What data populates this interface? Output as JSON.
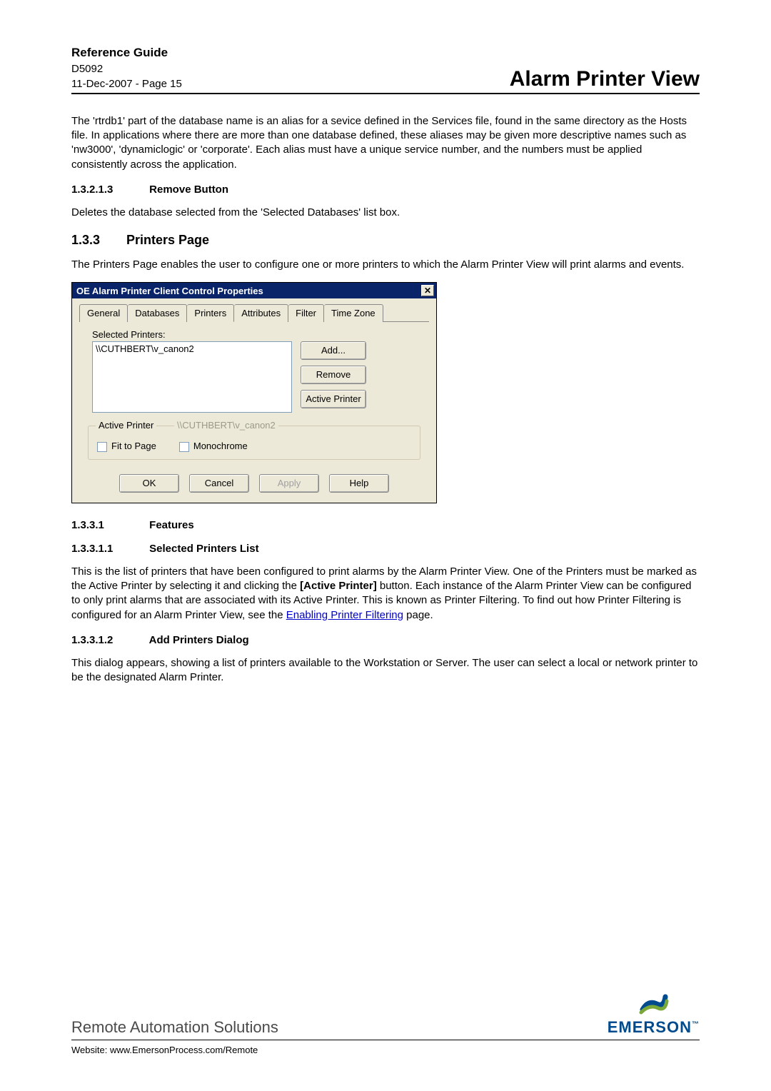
{
  "header": {
    "title": "Reference Guide",
    "doc_id": "D5092",
    "date_page": "11-Dec-2007 - Page 15",
    "section_title": "Alarm Printer View"
  },
  "para1": "The 'rtrdb1' part of the database name is an alias for a sevice defined in the Services file, found in the same directory as the Hosts file. In applications where there are more than one database defined, these aliases may be given more descriptive names such as 'nw3000', 'dynamiclogic' or 'corporate'. Each alias must have a unique service number, and the numbers must be applied consistently across the application.",
  "sec_13213": {
    "num": "1.3.2.1.3",
    "title": "Remove Button"
  },
  "para2": "Deletes the database selected from the 'Selected Databases' list box.",
  "sec_133": {
    "num": "1.3.3",
    "title": "Printers Page"
  },
  "para3": "The Printers Page enables the user to configure one or more printers to which the Alarm Printer View will print alarms and events.",
  "dialog": {
    "title": "OE Alarm Printer Client Control Properties",
    "tabs": [
      "General",
      "Databases",
      "Printers",
      "Attributes",
      "Filter",
      "Time Zone"
    ],
    "active_tab": "Printers",
    "selected_label": "Selected Printers:",
    "selected_items": [
      "\\\\CUTHBERT\\v_canon2"
    ],
    "btn_add": "Add...",
    "btn_remove": "Remove",
    "btn_active": "Active Printer",
    "group_legend": "Active Printer",
    "active_printer_name": "\\\\CUTHBERT\\v_canon2",
    "chk_fit": "Fit to Page",
    "chk_mono": "Monochrome",
    "btn_ok": "OK",
    "btn_cancel": "Cancel",
    "btn_apply": "Apply",
    "btn_help": "Help"
  },
  "sec_1331": {
    "num": "1.3.3.1",
    "title": "Features"
  },
  "sec_13311": {
    "num": "1.3.3.1.1",
    "title": "Selected Printers List"
  },
  "para4a": "This is the list of printers that have been configured to print alarms by the Alarm Printer View.  One of the Printers must be  marked as the Active Printer by selecting it and clicking the ",
  "para4b": "[Active Printer]",
  "para4c": " button. Each instance of the Alarm Printer View can be configured to only print alarms that are associated with its Active Printer. This is known as Printer Filtering. To find out how Printer Filtering is configured for an Alarm Printer View, see the ",
  "para4link": "Enabling Printer Filtering",
  "para4d": " page.",
  "sec_13312": {
    "num": "1.3.3.1.2",
    "title": "Add Printers Dialog"
  },
  "para5": "This dialog appears, showing a list of printers available to the Workstation or Server. The user can select a local or network printer to be the designated Alarm Printer.",
  "footer": {
    "brand": "Remote Automation Solutions",
    "website_label": "Website:  www.EmersonProcess.com/Remote",
    "logo_text": "EMERSON",
    "logo_sub": ""
  }
}
